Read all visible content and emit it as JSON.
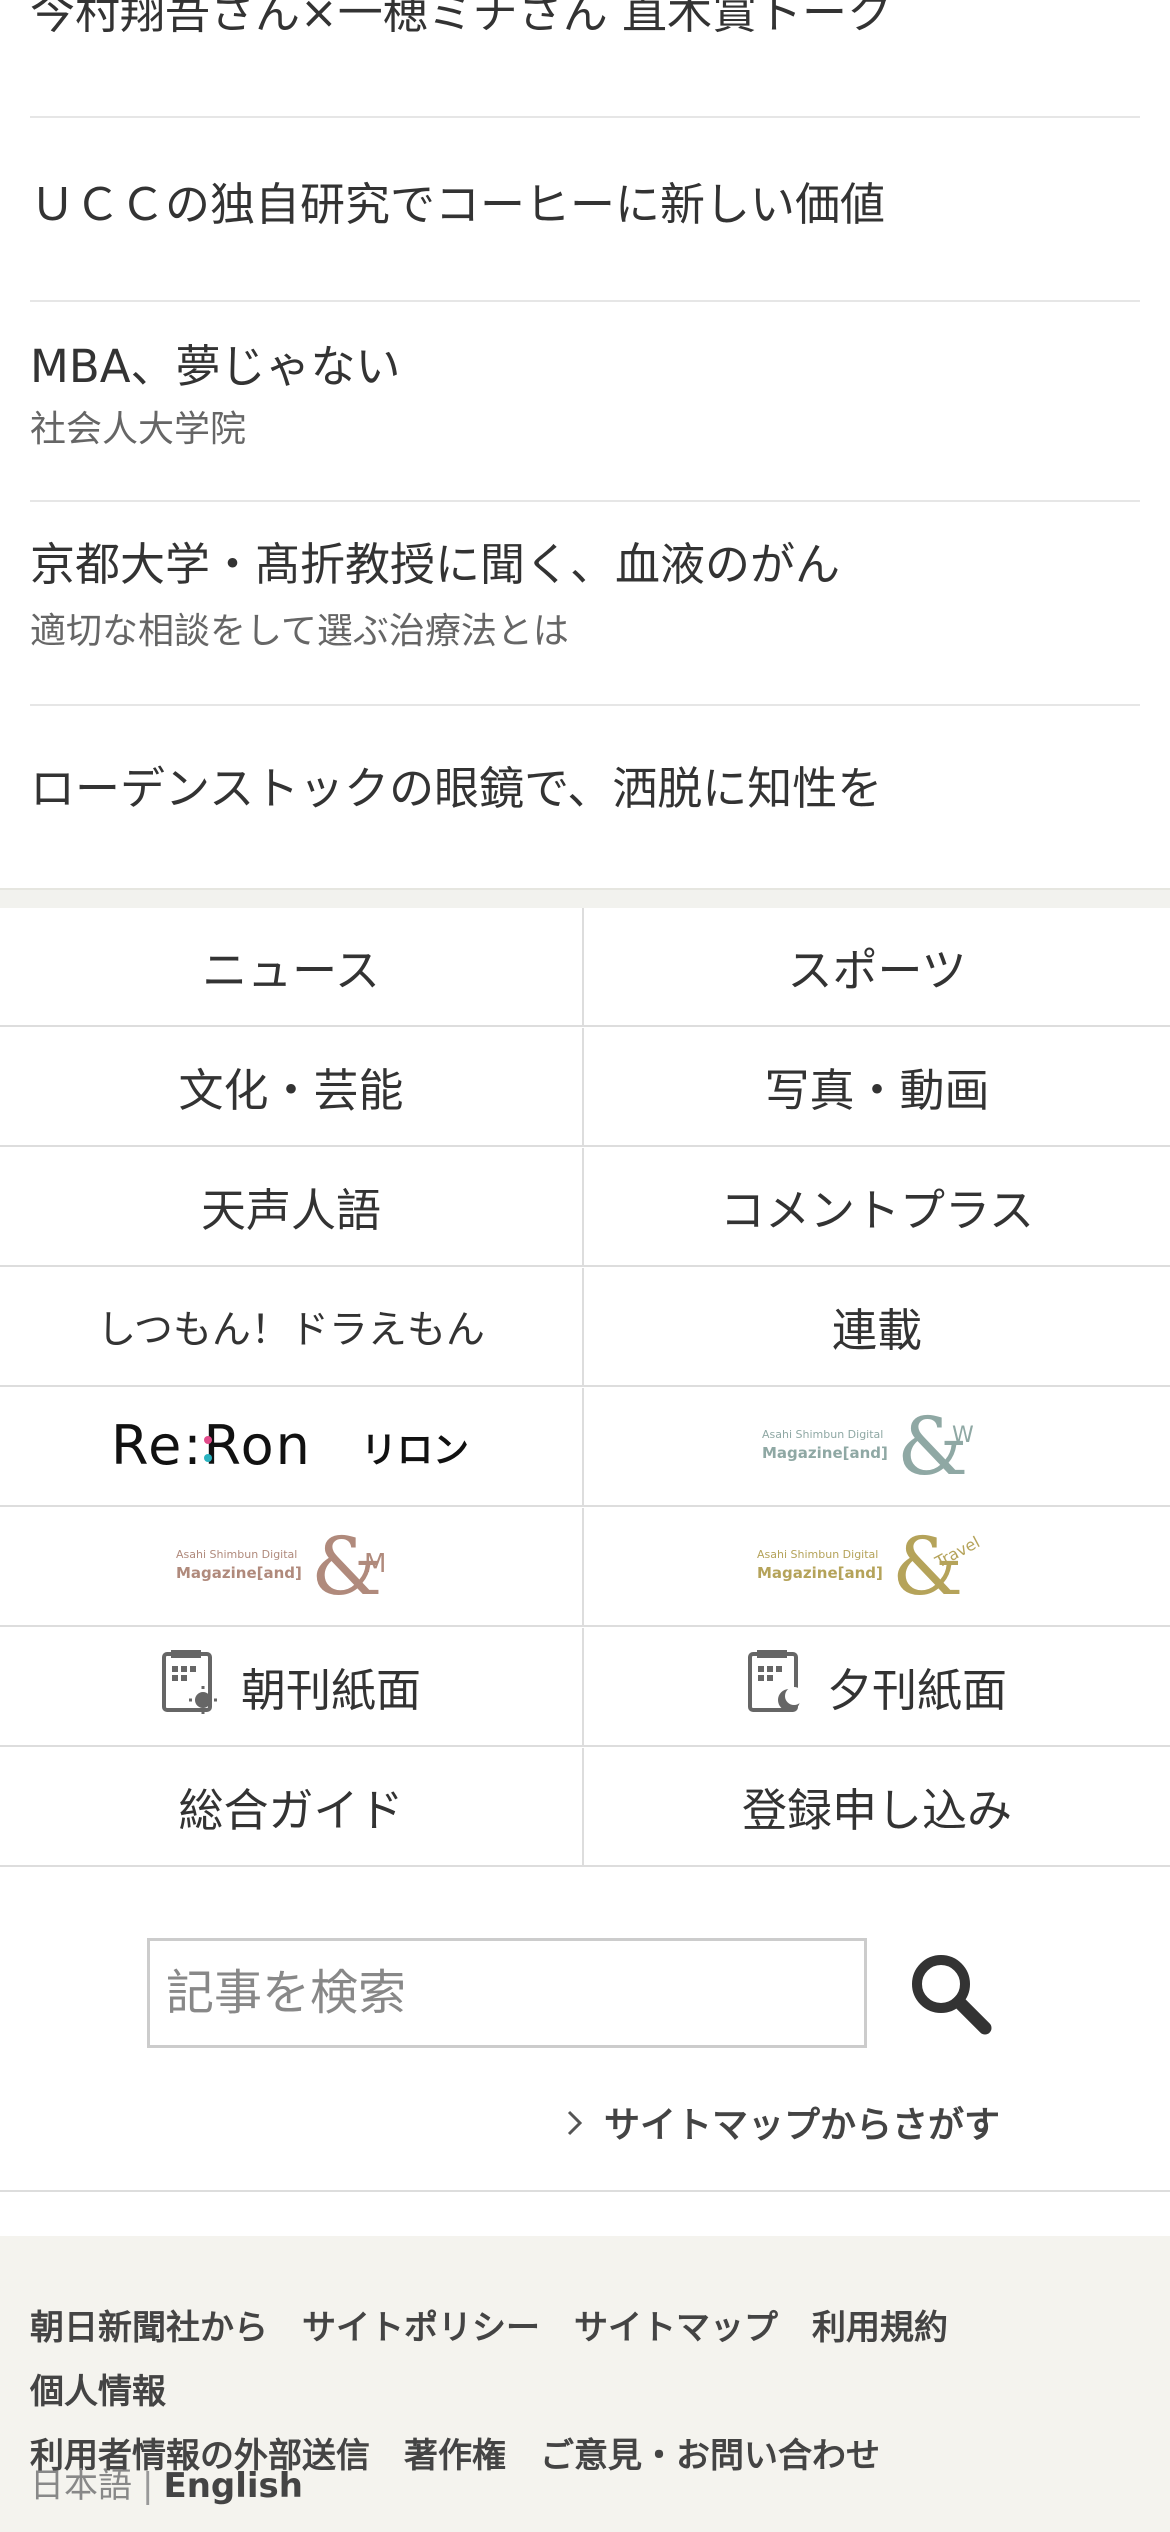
{
  "articles": [
    {
      "title": "今村翔吾さん×一穂ミチさん 直木賞トーク",
      "subtitle": ""
    },
    {
      "title": "ＵＣＣの独自研究でコーヒーに新しい価値",
      "subtitle": ""
    },
    {
      "title": "MBA、夢じゃない",
      "subtitle": "社会人大学院"
    },
    {
      "title": "京都大学・髙折教授に聞く、血液のがん",
      "subtitle": "適切な相談をして選ぶ治療法とは"
    },
    {
      "title": "ローデンストックの眼鏡で、洒脱に知性を",
      "subtitle": ""
    }
  ],
  "menu": {
    "news": "ニュース",
    "sports": "スポーツ",
    "culture": "文化・芸能",
    "photo_video": "写真・動画",
    "tensei_jingo": "天声人語",
    "comment_plus": "コメントプラス",
    "doraemon": "しつもん！ドラえもん",
    "series": "連載",
    "reron_logo": "Re:Ron",
    "reron_kana": "リロン",
    "andw_small": "Asahi Shimbun Digital",
    "andw_magazine": "Magazine[and]",
    "andw_letter": "W",
    "andm_small": "Asahi Shimbun Digital",
    "andm_magazine": "Magazine[and]",
    "andm_letter": "M",
    "andtravel_small": "Asahi Shimbun Digital",
    "andtravel_magazine": "Magazine[and]",
    "andtravel_letter": "Travel",
    "morning_edition": "朝刊紙面",
    "evening_edition": "夕刊紙面",
    "guide": "総合ガイド",
    "register": "登録申し込み"
  },
  "search": {
    "placeholder": "記事を検索",
    "sitemap_link": "サイトマップからさがす"
  },
  "footer": {
    "links": [
      "朝日新聞社から",
      "サイトポリシー",
      "サイトマップ",
      "利用規約",
      "個人情報",
      "利用者情報の外部送信",
      "著作権",
      "ご意見・お問い合わせ"
    ],
    "lang_ja": "日本語",
    "lang_sep": "|",
    "lang_en": "English"
  },
  "colors": {
    "andw": "#8fa8a4",
    "andm": "#b08a7c",
    "andtravel": "#b5a35a",
    "footer_bg": "#f4f3ee"
  },
  "icons": {
    "search": "search-icon",
    "morning": "newspaper-sun-icon",
    "evening": "newspaper-moon-icon",
    "chevron": "chevron-right-icon"
  }
}
